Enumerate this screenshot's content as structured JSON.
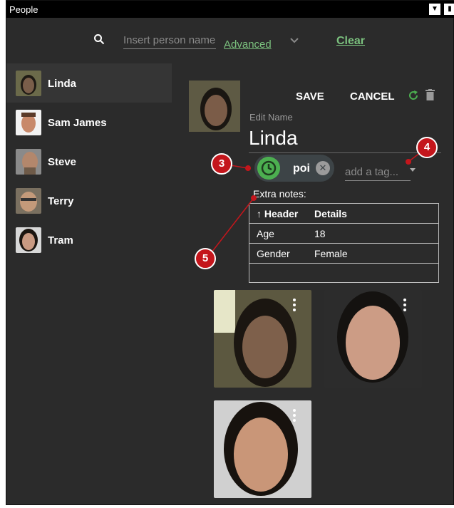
{
  "window": {
    "title": "People"
  },
  "search": {
    "placeholder": "Insert person name",
    "advanced_label": "Advanced",
    "clear_label": "Clear"
  },
  "people": [
    {
      "name": "Linda",
      "selected": true
    },
    {
      "name": "Sam James",
      "selected": false
    },
    {
      "name": "Steve",
      "selected": false
    },
    {
      "name": "Terry",
      "selected": false
    },
    {
      "name": "Tram",
      "selected": false
    }
  ],
  "detail": {
    "save_label": "SAVE",
    "cancel_label": "CANCEL",
    "edit_name_label": "Edit Name",
    "name_value": "Linda",
    "tag_chip": "poi",
    "tag_placeholder": "add a tag...",
    "notes_label": "Extra notes:",
    "table": {
      "headers": [
        "Header",
        "Details"
      ],
      "rows": [
        [
          "Age",
          "18"
        ],
        [
          "Gender",
          "Female"
        ]
      ]
    }
  },
  "callouts": [
    "3",
    "4",
    "5"
  ],
  "colors": {
    "accent": "#7bc17e",
    "chip_icon": "#4caf50",
    "callout": "#c4161c",
    "background": "#2b2b2b"
  },
  "icons": [
    "search-icon",
    "chevron-down-icon",
    "refresh-icon",
    "trash-icon",
    "clock-icon",
    "close-icon",
    "more-vert-icon"
  ]
}
